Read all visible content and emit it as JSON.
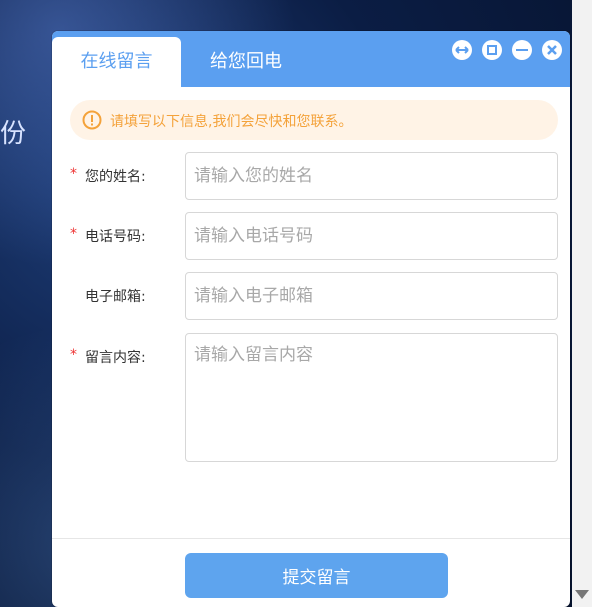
{
  "background": {
    "partial_text": "份"
  },
  "dialog": {
    "tabs": [
      "在线留言",
      "给您回电"
    ],
    "controls": {
      "restore": "restore-icon",
      "maximize": "maximize-icon",
      "minimize": "minimize-icon",
      "close": "close-icon"
    },
    "notice": "请填写以下信息,我们会尽快和您联系。",
    "form": {
      "name": {
        "required_mark": "*",
        "label": "您的姓名:",
        "placeholder": "请输入您的姓名"
      },
      "phone": {
        "required_mark": "*",
        "label": "电话号码:",
        "placeholder": "请输入电话号码"
      },
      "email": {
        "required_mark": "",
        "label": "电子邮箱:",
        "placeholder": "请输入电子邮箱"
      },
      "message": {
        "required_mark": "*",
        "label": "留言内容:",
        "placeholder": "请输入留言内容"
      }
    },
    "submit_label": "提交留言"
  },
  "colors": {
    "primary": "#5b9ff0",
    "notice_bg": "#fff3e6",
    "notice_text": "#f4a23a",
    "required": "#e33"
  }
}
